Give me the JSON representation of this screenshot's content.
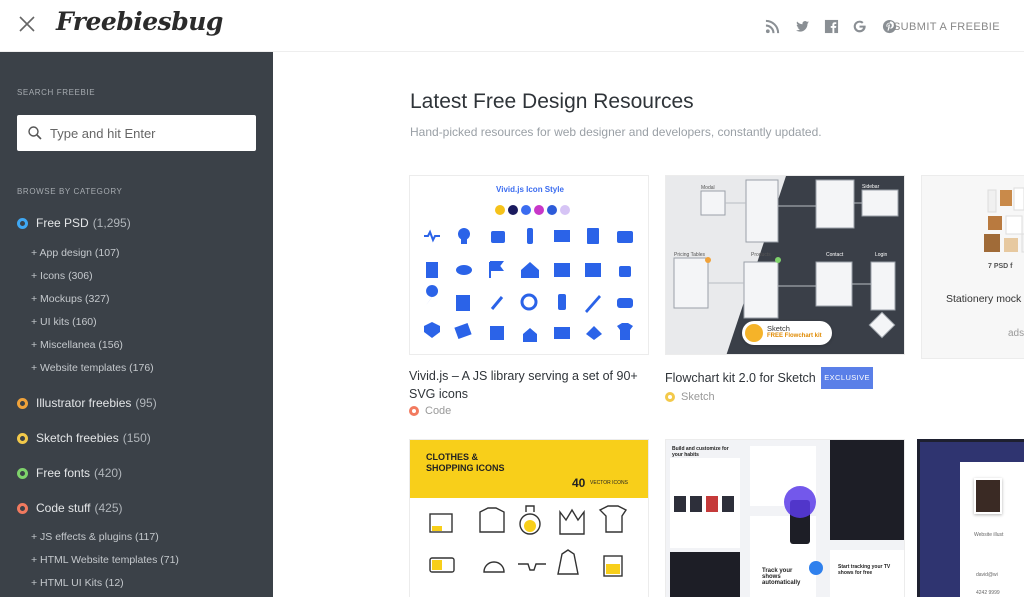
{
  "header": {
    "logo": "Freebiesbug",
    "submit_label": "SUBMIT A FREEBIE",
    "social": [
      "rss-icon",
      "twitter-icon",
      "facebook-icon",
      "google-icon",
      "pinterest-icon"
    ]
  },
  "sidebar": {
    "search_label": "SEARCH FREEBIE",
    "search_placeholder": "Type and hit Enter",
    "browse_label": "BROWSE BY CATEGORY",
    "categories": [
      {
        "label": "Free PSD",
        "count": "(1,295)",
        "color": "#3fa8f4"
      },
      {
        "label": "Illustrator freebies",
        "count": "(95)",
        "color": "#f0a23a"
      },
      {
        "label": "Sketch freebies",
        "count": "(150)",
        "color": "#f3c94a"
      },
      {
        "label": "Free fonts",
        "count": "(420)",
        "color": "#7ed26b"
      },
      {
        "label": "Code stuff",
        "count": "(425)",
        "color": "#f27a5f"
      }
    ],
    "psd_sub": [
      "+ App design (107)",
      "+ Icons (306)",
      "+ Mockups (327)",
      "+ UI kits (160)",
      "+ Miscellanea (156)",
      "+ Website templates (176)"
    ],
    "code_sub": [
      "+ JS effects & plugins (117)",
      "+ HTML Website templates (71)",
      "+ HTML UI Kits (12)"
    ]
  },
  "main": {
    "title": "Latest Free Design Resources",
    "subtitle": "Hand-picked resources for web designer and developers, constantly updated.",
    "cards": [
      {
        "title": "Vivid.js – A JS library serving a set of 90+ SVG icons",
        "category": "Code",
        "cat_color": "#f27a5f",
        "thumb_heading": "Vivid.js Icon Style"
      },
      {
        "title": "Flowchart kit 2.0 for Sketch",
        "badge": "EXCLUSIVE",
        "category": "Sketch",
        "cat_color": "#f3c94a",
        "thumb_pill_title": "Sketch",
        "thumb_pill_sub": "FREE Flowchart kit",
        "thumb_labels": [
          "Modal",
          "Sidebar",
          "Pricing Tables",
          "Products",
          "Contact",
          "Login"
        ]
      },
      {
        "title": "Stationery mock",
        "ad": "ads",
        "thumb_caption": "7 PSD f"
      }
    ],
    "row2": {
      "clothes_title": "CLOTHES & SHOPPING ICONS",
      "clothes_count": "40",
      "clothes_count_label": "VECTOR ICONS",
      "app_texts": [
        "Build and customize for your habits",
        "Track your shows automatically",
        "Start tracking your TV shows for free"
      ],
      "profile_field": "Website illust",
      "email_field": "david@wi",
      "phone_field": "4242 9999"
    }
  }
}
